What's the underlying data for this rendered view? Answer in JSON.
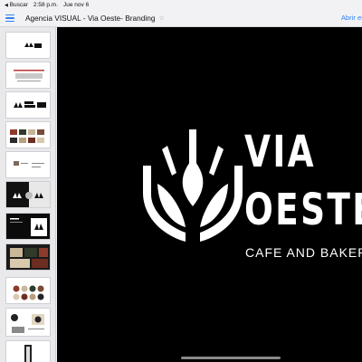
{
  "status_bar": {
    "back_label": "Buscar",
    "time": "2:58 p.m.",
    "date": "Jue nov 6"
  },
  "toolbar": {
    "title": "Agencia VISUAL - Via Oeste- Branding",
    "open_in_label": "Abrir en Ac"
  },
  "slide": {
    "brand_line1": "VIA",
    "brand_line2": "OESTE",
    "tagline": "CAFE AND BAKER"
  },
  "colors": {
    "accent": "#2f7ff6",
    "slide_background": "#000000",
    "logo": "#ffffff"
  },
  "sidebar": {
    "thumbnail_count": 11
  }
}
